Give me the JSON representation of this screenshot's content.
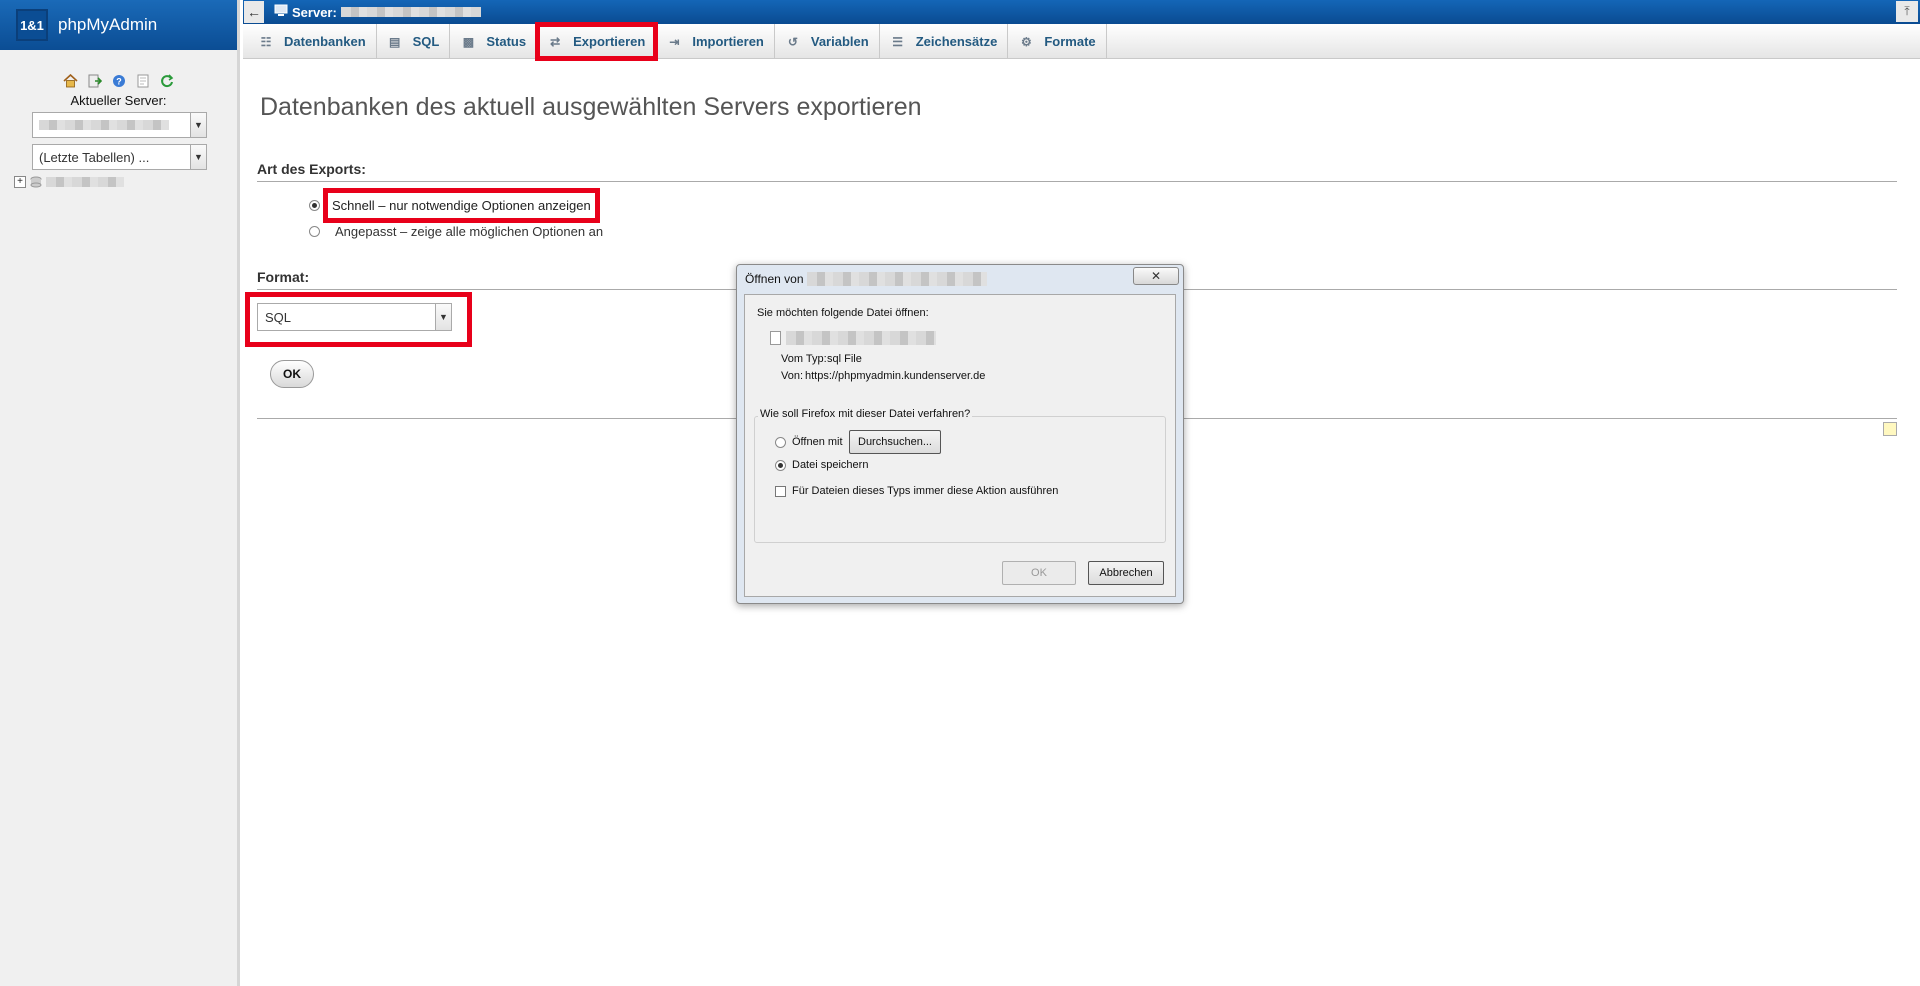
{
  "nav": {
    "brand_logo_text": "1&1",
    "brand": "phpMyAdmin",
    "server_label": "Aktueller Server:",
    "recent_tables": "(Letzte Tabellen) ...",
    "icons": [
      "home-icon",
      "logout-icon",
      "help-icon",
      "docs-icon",
      "reload-icon"
    ]
  },
  "topbar": {
    "back_symbol": "←",
    "server_prefix": "Server:",
    "collapse_symbol": "⤒"
  },
  "tabs": [
    {
      "label": "Datenbanken",
      "icon": "database-icon"
    },
    {
      "label": "SQL",
      "icon": "sql-icon"
    },
    {
      "label": "Status",
      "icon": "status-icon"
    },
    {
      "label": "Exportieren",
      "icon": "export-icon",
      "active": true
    },
    {
      "label": "Importieren",
      "icon": "import-icon"
    },
    {
      "label": "Variablen",
      "icon": "variables-icon"
    },
    {
      "label": "Zeichensätze",
      "icon": "charset-icon"
    },
    {
      "label": "Formate",
      "icon": "engines-icon"
    }
  ],
  "main": {
    "title": "Datenbanken des aktuell ausgewählten Servers exportieren",
    "export_type_heading": "Art des Exports:",
    "option_quick": "Schnell – nur notwendige Optionen anzeigen",
    "option_custom": "Angepasst – zeige alle möglichen Optionen an",
    "format_heading": "Format:",
    "format_value": "SQL",
    "ok_label": "OK"
  },
  "dialog": {
    "title_prefix": "Öffnen von",
    "close_symbol": "✕",
    "intro": "Sie möchten folgende Datei öffnen:",
    "type_label": "Vom Typ:",
    "type_value": "sql File",
    "from_label": "Von:",
    "from_value": "https://phpmyadmin.kundenserver.de",
    "question": "Wie soll Firefox mit dieser Datei verfahren?",
    "open_with": "Öffnen mit",
    "browse": "Durchsuchen...",
    "save_file": "Datei speichern",
    "always_action": "Für Dateien dieses Typs immer diese Aktion ausführen",
    "ok": "OK",
    "cancel": "Abbrechen"
  }
}
